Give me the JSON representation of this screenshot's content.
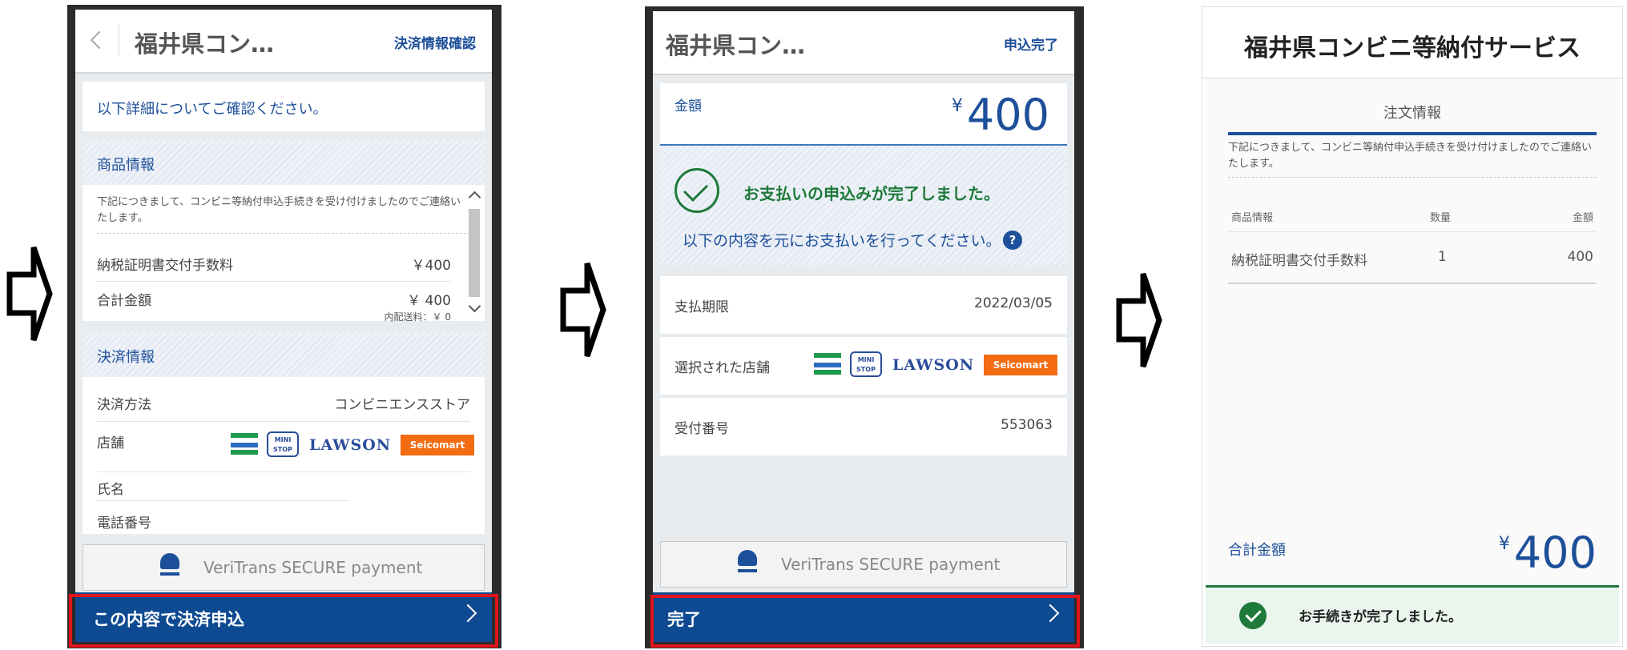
{
  "screen1": {
    "title": "福井県コン…",
    "header_link": "決済情報確認",
    "intro": "以下詳細についてご確認ください。",
    "product_section": "商品情報",
    "notice": "下記につきまして、コンビニ等納付申込手続きを受け付けましたのでご連絡いたします。",
    "item_name": "納税証明書交付手数料",
    "item_price": "￥400",
    "total_label": "合計金額",
    "total_value": "￥ 400",
    "shipping": "内配送料：￥ 0",
    "payment_section": "決済情報",
    "method_label": "決済方法",
    "method_value": "コンビニエンスストア",
    "store_label": "店舗",
    "name_label": "氏名",
    "phone_label": "電話番号",
    "veritrans": "VeriTrans SECURE payment",
    "submit": "この内容で決済申込"
  },
  "screen2": {
    "title": "福井県コン…",
    "header_link": "申込完了",
    "amount_label": "金額",
    "amount_yen": "¥",
    "amount_value": "400",
    "complete_msg": "お支払いの申込みが完了しました。",
    "instruction": "以下の内容を元にお支払いを行ってください。",
    "deadline_label": "支払期限",
    "deadline_value": "2022/03/05",
    "store_label": "選択された店舗",
    "receipt_label": "受付番号",
    "receipt_value": "553063",
    "veritrans": "VeriTrans SECURE payment",
    "done": "完了"
  },
  "screen3": {
    "title": "福井県コンビニ等納付サービス",
    "tab": "注文情報",
    "notice": "下記につきまして、コンビニ等納付申込手続きを受け付けましたのでご連絡いたします。",
    "col_item": "商品情報",
    "col_qty": "数量",
    "col_amount": "金額",
    "item_name": "納税証明書交付手数料",
    "item_qty": "1",
    "item_amount": "400",
    "total_label": "合計金額",
    "total_yen": "¥",
    "total_value": "400",
    "complete_msg": "お手続きが完了しました。"
  },
  "logos": {
    "familymart": "FamilyMart",
    "ministop": "MINI STOP",
    "lawson": "LAWSON",
    "seicomart": "Seicomart"
  },
  "colors": {
    "accent": "#1d4f9a",
    "button": "#0e4a92",
    "highlight": "#e2141b",
    "success": "#1e7a3a"
  }
}
